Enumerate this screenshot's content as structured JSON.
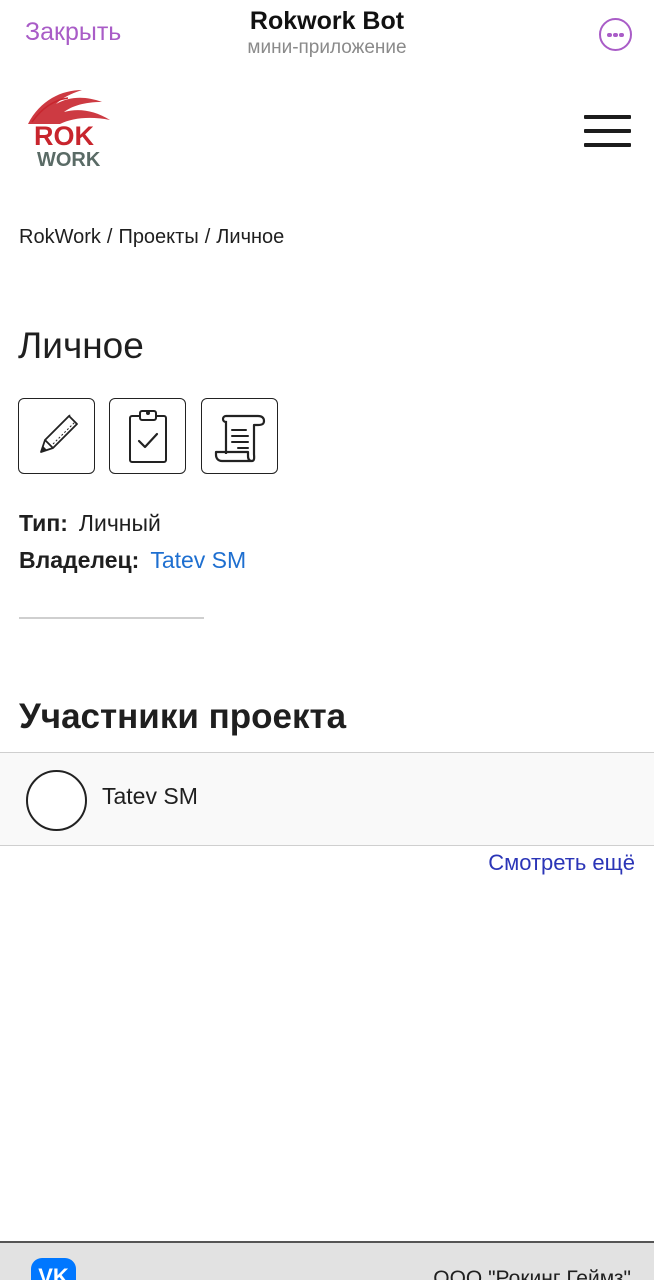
{
  "telegram": {
    "close_label": "Закрыть",
    "bot_title": "Rokwork Bot",
    "bot_subtitle": "мини-приложение",
    "more_icon": "more-icon"
  },
  "site": {
    "logo": {
      "line1": "ROK",
      "line2": "WORK",
      "colors": {
        "red": "#c8252d",
        "grey": "#5a6b66"
      }
    },
    "menu_icon": "hamburger-icon"
  },
  "breadcrumb": [
    "RokWork",
    "Проекты",
    "Личное"
  ],
  "page": {
    "title": "Личное",
    "actions": [
      {
        "name": "edit",
        "icon": "pencil-icon"
      },
      {
        "name": "tasks",
        "icon": "clipboard-check-icon"
      },
      {
        "name": "document",
        "icon": "scroll-document-icon"
      }
    ]
  },
  "meta": {
    "type_label": "Тип:",
    "type_value": "Личный",
    "owner_label": "Владелец:",
    "owner_value": "Tatev SM"
  },
  "members": {
    "title": "Участники проекта",
    "items": [
      {
        "name": "Tatev SM"
      }
    ],
    "see_more": "Смотреть ещё"
  },
  "footer": {
    "vk_icon": "vk-icon",
    "vk_label": "VK",
    "company": "ООО \"Рокинг Геймз\""
  },
  "colors": {
    "accent": "#a95cc7",
    "link": "#1e6fd0",
    "see_more": "#2b35b7"
  }
}
